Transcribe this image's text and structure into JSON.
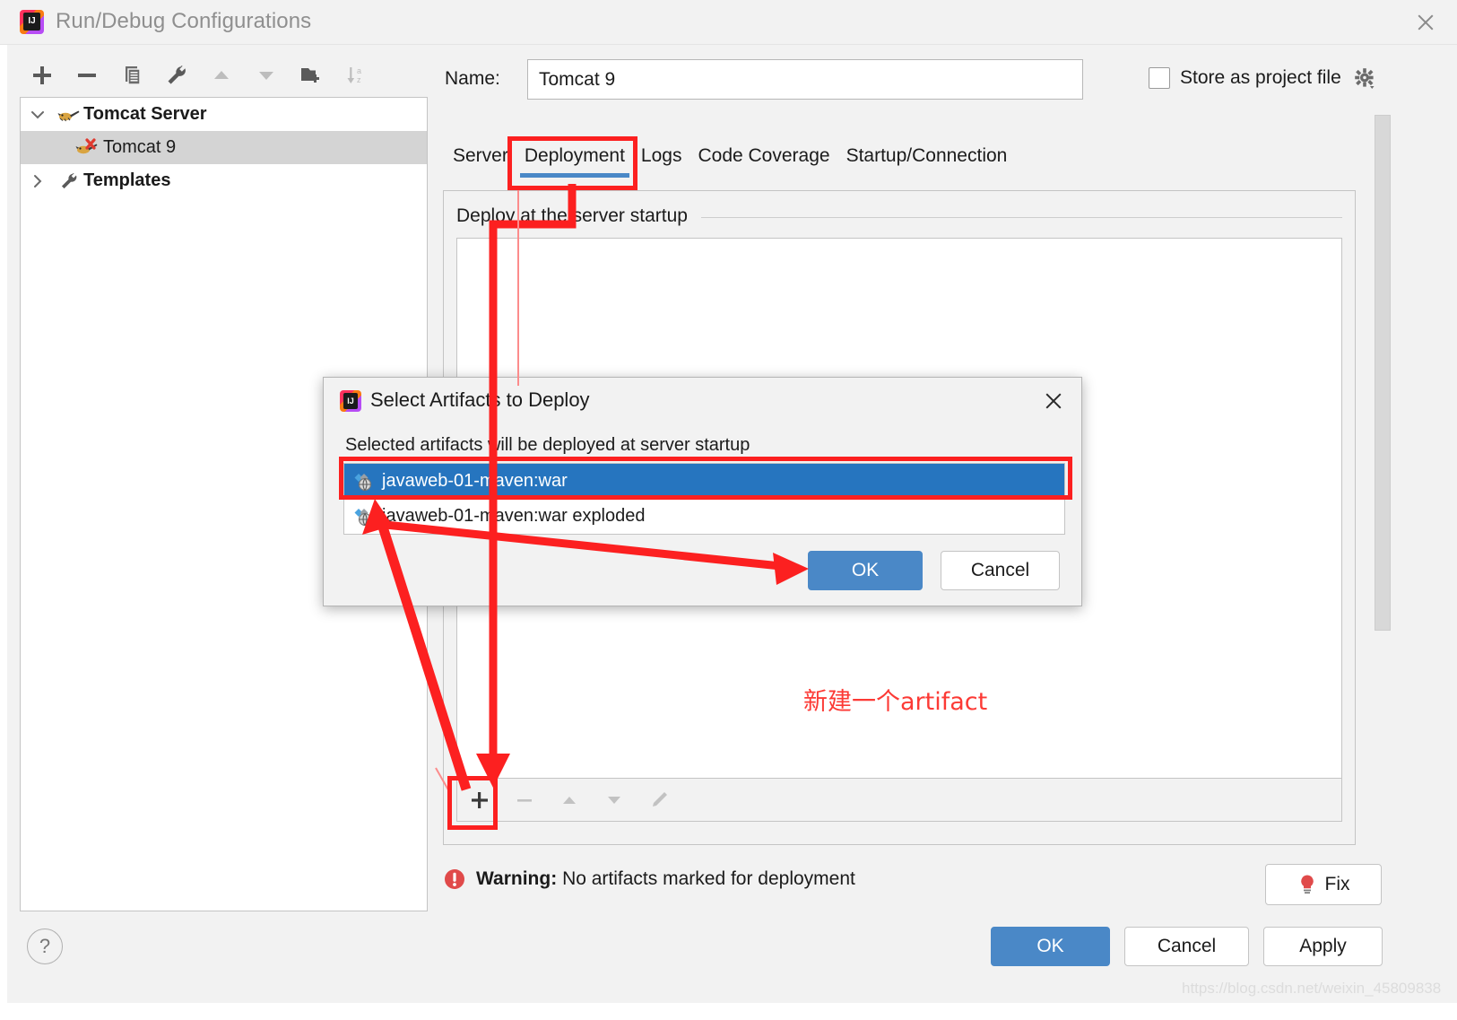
{
  "window": {
    "title": "Run/Debug Configurations",
    "close_icon": "close-icon",
    "logo_icon": "intellij-idea-logo-icon"
  },
  "toolbar": {
    "items": [
      {
        "name": "add-button",
        "icon": "plus-icon",
        "enabled": true
      },
      {
        "name": "remove-button",
        "icon": "minus-icon",
        "enabled": true
      },
      {
        "name": "copy-button",
        "icon": "copy-icon",
        "enabled": true
      },
      {
        "name": "edit-templates-button",
        "icon": "wrench-icon",
        "enabled": true
      },
      {
        "name": "move-up-button",
        "icon": "arrow-up-icon",
        "enabled": false
      },
      {
        "name": "move-down-button",
        "icon": "arrow-down-icon",
        "enabled": false
      },
      {
        "name": "new-folder-button",
        "icon": "folder-add-icon",
        "enabled": true
      },
      {
        "name": "sort-button",
        "icon": "sort-alpha-icon",
        "enabled": false
      }
    ]
  },
  "tree": {
    "nodes": [
      {
        "label": "Tomcat Server",
        "icon": "tomcat-icon",
        "expanded": true,
        "selected": false,
        "bold": true,
        "indent": 0
      },
      {
        "label": "Tomcat 9",
        "icon": "tomcat-error-icon",
        "expanded": null,
        "selected": true,
        "bold": false,
        "indent": 1
      },
      {
        "label": "Templates",
        "icon": "wrench-icon",
        "expanded": false,
        "selected": false,
        "bold": true,
        "indent": 0
      }
    ]
  },
  "name_field": {
    "label": "Name:",
    "value": "Tomcat 9",
    "placeholder": ""
  },
  "store_as_project_file": {
    "label": "Store as project file",
    "checked": false,
    "gear_icon": "gear-dropdown-icon"
  },
  "tabs": [
    {
      "label": "Server",
      "active": false
    },
    {
      "label": "Deployment",
      "active": true
    },
    {
      "label": "Logs",
      "active": false
    },
    {
      "label": "Code Coverage",
      "active": false
    },
    {
      "label": "Startup/Connection",
      "active": false
    }
  ],
  "deployment_panel": {
    "group_title": "Deploy at the server startup",
    "list_items": [],
    "minibar": [
      {
        "name": "add-artifact-button",
        "icon": "plus-icon",
        "enabled": true
      },
      {
        "name": "remove-artifact-button",
        "icon": "minus-icon",
        "enabled": false
      },
      {
        "name": "move-up-artifact-button",
        "icon": "arrow-up-icon",
        "enabled": false
      },
      {
        "name": "move-down-artifact-button",
        "icon": "arrow-down-icon",
        "enabled": false
      },
      {
        "name": "edit-artifact-button",
        "icon": "pencil-icon",
        "enabled": false
      }
    ]
  },
  "annotation": {
    "chinese_note": "新建一个artifact",
    "highlight_color": "#fc2020",
    "arrow_color": "#fc2020"
  },
  "warning": {
    "icon": "error-exclamation-icon",
    "prefix": "Warning:",
    "message": "No artifacts marked for deployment",
    "fix_label": "Fix",
    "fix_icon": "lightbulb-error-icon"
  },
  "footer": {
    "help_label": "?",
    "ok_label": "OK",
    "cancel_label": "Cancel",
    "apply_label": "Apply"
  },
  "modal": {
    "logo_icon": "intellij-idea-logo-icon",
    "title": "Select Artifacts to Deploy",
    "close_icon": "close-icon",
    "subtitle": "Selected artifacts will be deployed at server startup",
    "artifacts": [
      {
        "label": "javaweb-01-maven:war",
        "icon": "artifact-war-icon",
        "selected": true
      },
      {
        "label": "javaweb-01-maven:war exploded",
        "icon": "artifact-war-exploded-icon",
        "selected": false
      }
    ],
    "ok_label": "OK",
    "cancel_label": "Cancel"
  },
  "watermark": "https://blog.csdn.net/weixin_45809838",
  "colors": {
    "accent_blue": "#4a88c7",
    "selection_blue": "#2675bf",
    "annotation_red": "#fc2020",
    "warning_red": "#e04a4a",
    "window_bg": "#f2f2f2"
  }
}
